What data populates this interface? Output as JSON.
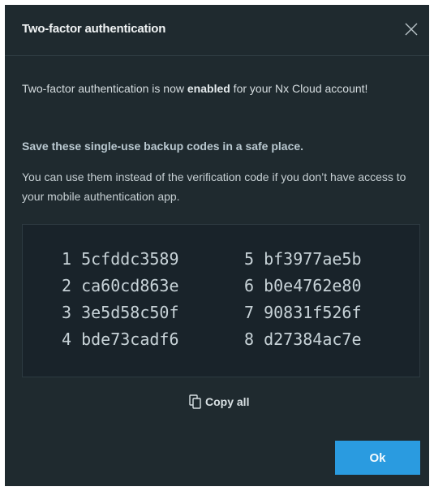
{
  "dialog": {
    "title": "Two-factor authentication",
    "close_icon": "close-icon",
    "message_prefix": "Two-factor authentication is now ",
    "message_status": "enabled",
    "message_suffix": " for your Nx Cloud account!",
    "save_heading": "Save these single-use backup codes in a safe place.",
    "description": "You can use them instead of the verification code if you don’t have access to your mobile authentication app.",
    "codes_left": [
      {
        "num": "1",
        "code": "5cfddc3589"
      },
      {
        "num": "2",
        "code": "ca60cd863e"
      },
      {
        "num": "3",
        "code": "3e5d58c50f"
      },
      {
        "num": "4",
        "code": "bde73cadf6"
      }
    ],
    "codes_right": [
      {
        "num": "5",
        "code": "bf3977ae5b"
      },
      {
        "num": "6",
        "code": "b0e4762e80"
      },
      {
        "num": "7",
        "code": "90831f526f"
      },
      {
        "num": "8",
        "code": "d27384ac7e"
      }
    ],
    "copy_all_label": "Copy all",
    "copy_icon": "copy-icon",
    "ok_label": "Ok"
  },
  "colors": {
    "dialog_bg": "#1f2a2f",
    "codes_bg": "#19232a",
    "accent": "#2a9be0"
  }
}
